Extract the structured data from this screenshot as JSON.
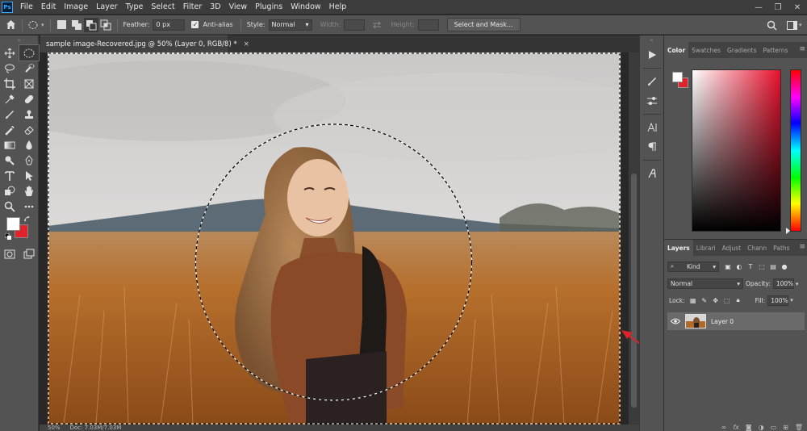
{
  "app": {
    "logo_text": "Ps"
  },
  "menu": [
    "File",
    "Edit",
    "Image",
    "Layer",
    "Type",
    "Select",
    "Filter",
    "3D",
    "View",
    "Plugins",
    "Window",
    "Help"
  ],
  "window_controls": {
    "minimize": "—",
    "restore": "❐",
    "close": "✕"
  },
  "options": {
    "feather_label": "Feather:",
    "feather_value": "0 px",
    "antialias_label": "Anti-alias",
    "antialias_checked": "✓",
    "style_label": "Style:",
    "style_value": "Normal",
    "width_label": "Width:",
    "height_label": "Height:",
    "select_mask_label": "Select and Mask..."
  },
  "document": {
    "tab_title": "sample image-Recovered.jpg @ 50% (Layer 0, RGB/8) *",
    "tab_close": "×",
    "zoom": "50%",
    "doc_info": "Doc: 7.03M/7.03M"
  },
  "colors": {
    "foreground": "#ffffff",
    "background": "#e0232a",
    "accent_arrow": "#e0232a"
  },
  "color_panel": {
    "tabs": [
      "Color",
      "Swatches",
      "Gradients",
      "Patterns"
    ],
    "active_tab": "Color"
  },
  "layers_panel": {
    "tabs": [
      "Layers",
      "Librari",
      "Adjust",
      "Chann",
      "Paths"
    ],
    "active_tab": "Layers",
    "filter_kind": "Kind",
    "blend_mode": "Normal",
    "opacity_label": "Opacity:",
    "opacity_value": "100%",
    "lock_label": "Lock:",
    "fill_label": "Fill:",
    "fill_value": "100%",
    "layers": [
      {
        "name": "Layer 0",
        "visible": true
      }
    ],
    "footer_icons": [
      "link-icon",
      "fx-icon",
      "mask-icon",
      "adjustment-icon",
      "group-icon",
      "new-layer-icon",
      "trash-icon"
    ]
  },
  "dock": {
    "icons": [
      "play-icon",
      "brush-settings-icon",
      "adjustments-icon",
      "character-icon",
      "paragraph-icon",
      "glyphs-icon"
    ]
  },
  "tools": [
    "move-tool-icon",
    "elliptical-marquee-icon",
    "lasso-icon",
    "quick-select-icon",
    "crop-icon",
    "frame-icon",
    "eyedropper-icon",
    "healing-icon",
    "brush-icon",
    "stamp-icon",
    "history-brush-icon",
    "eraser-icon",
    "gradient-icon",
    "blur-icon",
    "dodge-icon",
    "pen-icon",
    "type-icon",
    "path-select-icon",
    "shape-icon",
    "hand-icon",
    "zoom-icon",
    "more-icon"
  ]
}
